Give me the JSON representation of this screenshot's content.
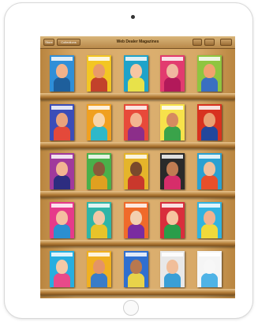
{
  "toolbar": {
    "left_button_1": "Store",
    "left_button_2": "Collections",
    "title": "Web Dealer Magazines",
    "right_button_1": "",
    "right_button_2": "",
    "right_button_3": ""
  },
  "colors": {
    "shelf_wood": "#d7a866",
    "toolbar": "#c9a066",
    "device_bezel": "#ffffff"
  },
  "shelves": [
    {
      "covers": [
        {
          "bg": "#2f8fd8",
          "face": "#f2b28a",
          "body": "#1e5f9c"
        },
        {
          "bg": "#f3c623",
          "face": "#e89a6a",
          "body": "#c2412b"
        },
        {
          "bg": "#1fa3c9",
          "face": "#f6c6a2",
          "body": "#e8e24a"
        },
        {
          "bg": "#e23b6f",
          "face": "#f0b8a0",
          "body": "#b2195a"
        },
        {
          "bg": "#8fc540",
          "face": "#f1a26f",
          "body": "#3a6fc1"
        }
      ]
    },
    {
      "covers": [
        {
          "bg": "#3b4db8",
          "face": "#e9a37c",
          "body": "#e4493a"
        },
        {
          "bg": "#f0a020",
          "face": "#f7d4a8",
          "body": "#2eb8c9"
        },
        {
          "bg": "#e84a3a",
          "face": "#f3b591",
          "body": "#8c2e8a"
        },
        {
          "bg": "#f7e24b",
          "face": "#d68b60",
          "body": "#3aa34a"
        },
        {
          "bg": "#d8321f",
          "face": "#e9a072",
          "body": "#23479c"
        }
      ]
    },
    {
      "covers": [
        {
          "bg": "#a03a9c",
          "face": "#f2b592",
          "body": "#2d2d80"
        },
        {
          "bg": "#4ab04a",
          "face": "#8a5a3a",
          "body": "#e0a020"
        },
        {
          "bg": "#e5b52a",
          "face": "#7a4a2c",
          "body": "#c9382c"
        },
        {
          "bg": "#2a2a2a",
          "face": "#c07c52",
          "body": "#d62d6a"
        },
        {
          "bg": "#2aa1d2",
          "face": "#f0c09a",
          "body": "#e84f2a"
        }
      ]
    },
    {
      "covers": [
        {
          "bg": "#e63a8a",
          "face": "#f4bea0",
          "body": "#2b8fd0"
        },
        {
          "bg": "#2fb5a8",
          "face": "#f2c8a6",
          "body": "#e8c32a"
        },
        {
          "bg": "#f06a2a",
          "face": "#f3d0b0",
          "body": "#7a2ca0"
        },
        {
          "bg": "#d92e3c",
          "face": "#f6c3a0",
          "body": "#2a9d4a"
        },
        {
          "bg": "#31b3e0",
          "face": "#f2b28e",
          "body": "#f0d93a"
        }
      ]
    },
    {
      "covers": [
        {
          "bg": "#27aee0",
          "face": "#f4c9a6",
          "body": "#e84a8a"
        },
        {
          "bg": "#f0b020",
          "face": "#e49466",
          "body": "#3a7cc8"
        },
        {
          "bg": "#2f6fd0",
          "face": "#b8784e",
          "body": "#e8d34a"
        },
        {
          "bg": "#e8e8e8",
          "face": "#f1be99",
          "body": "#3a9fd6"
        },
        {
          "bg": "#f5f5f5",
          "face": "#f7f7f7",
          "body": "#4fb3e6"
        }
      ]
    }
  ]
}
